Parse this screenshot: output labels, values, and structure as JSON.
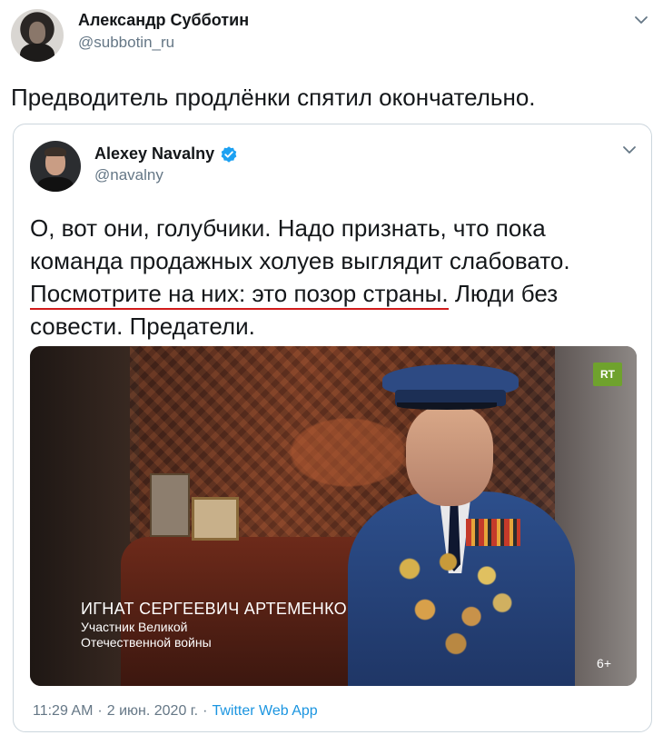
{
  "outer_tweet": {
    "author_name": "Александр Субботин",
    "author_handle": "@subbotin_ru",
    "text": "Предводитель продлёнки спятил окончательно.",
    "menu_icon": "chevron-down-icon"
  },
  "quoted_tweet": {
    "author_name": "Alexey Navalny",
    "verified_icon": "verified-badge-icon",
    "author_handle": "@navalny",
    "menu_icon": "chevron-down-icon",
    "text_before": "О, вот они, голубчики. Надо признать, что пока команда продажных холуев выглядит слабовато. ",
    "text_underlined": "Посмотрите на них: это позор страны.",
    "text_after": " Люди без совести. Предатели.",
    "underline_color": "#d11b1b",
    "media": {
      "channel_logo": "RT",
      "caption_name": "ИГНАТ СЕРГЕЕВИЧ АРТЕМЕНКО",
      "caption_role_line1": "Участник Великой",
      "caption_role_line2": "Отечественной войны",
      "age_rating": "6+"
    }
  },
  "meta": {
    "time": "11:29 AM",
    "separator": "·",
    "date": "2 июн. 2020 г.",
    "app": "Twitter Web App"
  },
  "colors": {
    "text": "#14171a",
    "secondary": "#657786",
    "link": "#1b95e0",
    "verified": "#1da1f2",
    "border": "#ccd6dd"
  }
}
